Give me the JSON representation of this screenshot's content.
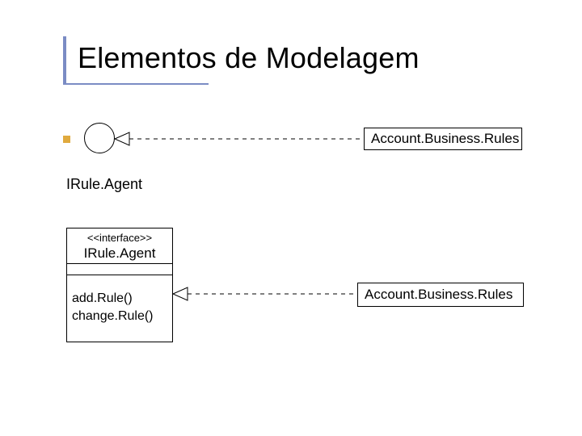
{
  "title": "Elementos de Modelagem",
  "irule_label": "IRule.Agent",
  "interface_box": {
    "stereotype": "<<interface>>",
    "name": "IRule.Agent",
    "operations": [
      "add.Rule()",
      "change.Rule()"
    ]
  },
  "account_box_1": "Account.Business.Rules",
  "account_box_2": "Account.Business.Rules"
}
